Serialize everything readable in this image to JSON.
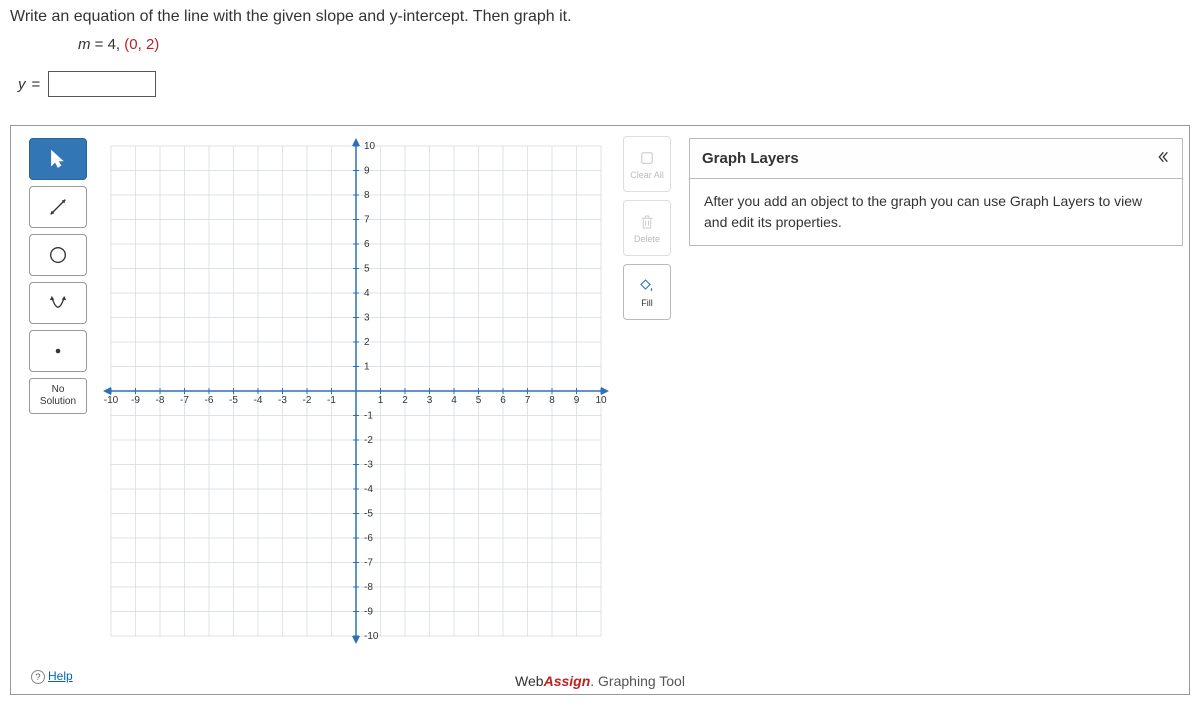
{
  "prompt": "Write an equation of the line with the given slope and y-intercept. Then graph it.",
  "given_m": "m",
  "given_eq": " = 4, ",
  "given_point": "(0, 2)",
  "answer": {
    "var": "y",
    "eq": "=",
    "value": ""
  },
  "toolbox": {
    "no_solution": "No\nSolution"
  },
  "right_tools": {
    "clear": "Clear All",
    "delete": "Delete",
    "fill": "Fill"
  },
  "layers": {
    "title": "Graph Layers",
    "body": "After you add an object to the graph you can use Graph Layers to view and edit its properties."
  },
  "help": "Help",
  "footer": {
    "w": "Web",
    "a": "Assign",
    "rest": ". Graphing Tool"
  },
  "chart_data": {
    "type": "scatter",
    "title": "",
    "xlabel": "",
    "ylabel": "",
    "xlim": [
      -10,
      10
    ],
    "ylim": [
      -10,
      10
    ],
    "xticks": [
      -10,
      -9,
      -8,
      -7,
      -6,
      -5,
      -4,
      -3,
      -2,
      -1,
      1,
      2,
      3,
      4,
      5,
      6,
      7,
      8,
      9,
      10
    ],
    "yticks": [
      -10,
      -9,
      -8,
      -7,
      -6,
      -5,
      -4,
      -3,
      -2,
      -1,
      1,
      2,
      3,
      4,
      5,
      6,
      7,
      8,
      9,
      10
    ],
    "grid": true,
    "series": []
  }
}
